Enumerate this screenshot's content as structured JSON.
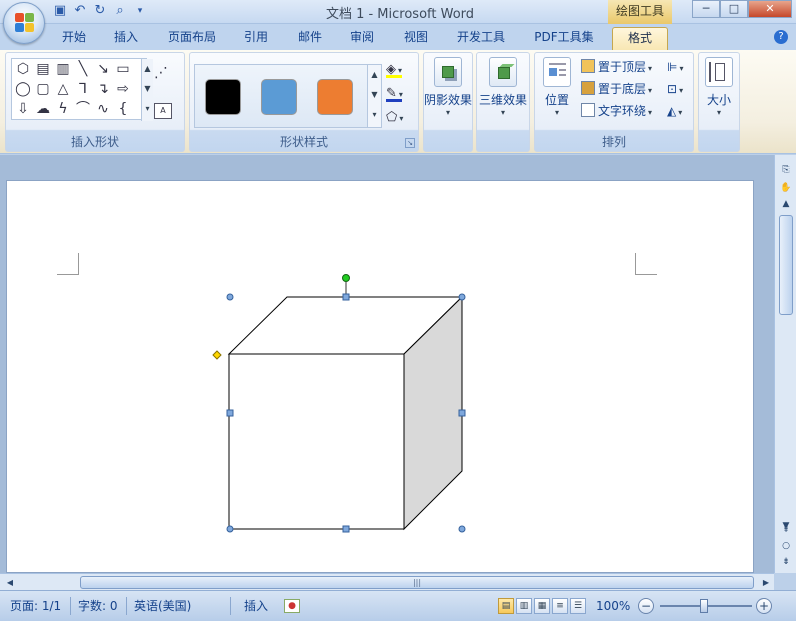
{
  "window": {
    "title": "文档 1 - Microsoft Word",
    "context_tab_title": "绘图工具",
    "controls": {
      "minimize": "─",
      "maximize": "□",
      "close": "✕"
    }
  },
  "quick_access": [
    {
      "name": "save-icon",
      "glyph": "💾"
    },
    {
      "name": "undo-icon",
      "glyph": "↶"
    },
    {
      "name": "repeat-icon",
      "glyph": "↻"
    },
    {
      "name": "print-preview-icon",
      "glyph": "🔍"
    }
  ],
  "tabs": [
    "开始",
    "插入",
    "页面布局",
    "引用",
    "邮件",
    "审阅",
    "视图",
    "开发工具",
    "PDF工具集",
    "格式"
  ],
  "active_tab": "格式",
  "help": "?",
  "ribbon": {
    "insert_shapes": {
      "label": "插入形状"
    },
    "shape_styles": {
      "label": "形状样式",
      "swatches": [
        "#000000",
        "#5b9bd5",
        "#ed7d31"
      ]
    },
    "shadow_effects": {
      "label": "阴影效果"
    },
    "threed_effects": {
      "label": "三维效果"
    },
    "arrange": {
      "label": "排列",
      "position": "位置",
      "bring_to_front": "置于顶层",
      "send_to_back": "置于底层",
      "text_wrapping": "文字环绕"
    },
    "size": {
      "label": "大小"
    }
  },
  "status": {
    "page": "页面: 1/1",
    "words": "字数: 0",
    "language": "英语(美国)",
    "mode": "插入",
    "zoom": "100%"
  },
  "colors": {
    "accent": "#15428b",
    "selection_handle": "#4f81bd",
    "rotation_handle": "#22cc22",
    "adjust_handle": "#ffd700",
    "cube_side": "#d9d9d9"
  }
}
